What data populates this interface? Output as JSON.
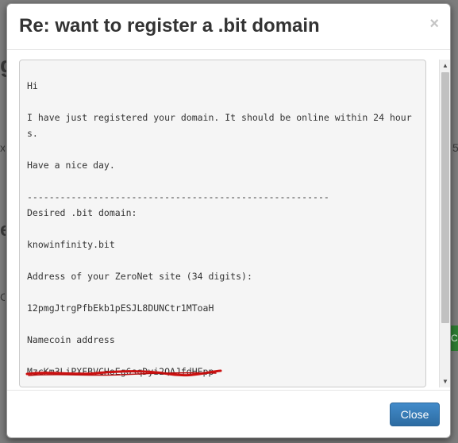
{
  "modal": {
    "title": "Re: want to register a .bit domain",
    "close_symbol": "×",
    "close_button_label": "Close"
  },
  "message": {
    "greeting": "Hi",
    "line1": "I have just registered your domain. It should be online within 24 hours.",
    "line2": "Have a nice day.",
    "separator": "-------------------------------------------------------",
    "label_domain": "Desired .bit domain:",
    "domain": "knowinfinity.bit",
    "label_address": "Address of your ZeroNet site (34 digits):",
    "address": "12pmgJtrgPfbEkb1pESJL8DUNCtr1MToaH",
    "label_namecoin": "Namecoin address",
    "namecoin_address": "MzcKm3LiPXFBVCHoEg6sqDyi2QAJfdHEpp"
  },
  "background": {
    "frag1": "g",
    "frag2": "x",
    "frag3": "e",
    "frag4": "C",
    "frag5": "5",
    "green_badge": "C"
  },
  "icons": {
    "scroll_up": "scroll-up-arrow-icon",
    "scroll_down": "scroll-down-arrow-icon"
  },
  "colors": {
    "primary_button": "#337ab7",
    "scribble": "#cc1111"
  }
}
